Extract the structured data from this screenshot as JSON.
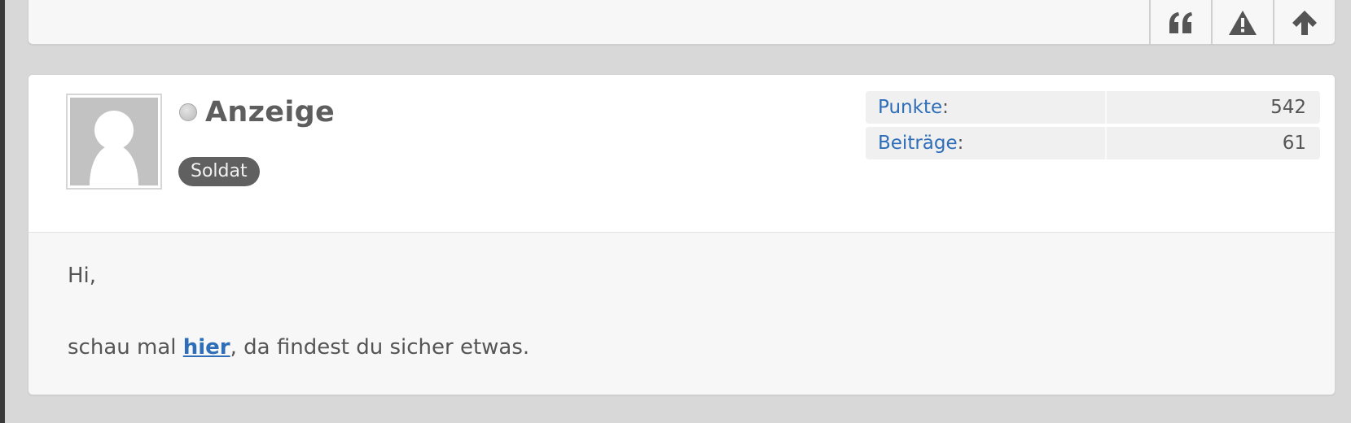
{
  "previous_post": {
    "actions": [
      {
        "name": "quote-button",
        "icon": "quote-icon"
      },
      {
        "name": "report-button",
        "icon": "warning-icon"
      },
      {
        "name": "scroll-top-button",
        "icon": "arrow-up-icon"
      }
    ]
  },
  "post": {
    "author": {
      "name": "Anzeige",
      "online_status": "offline",
      "rank": "Soldat",
      "avatar_icon": "default-avatar-icon"
    },
    "stats": [
      {
        "label": "Punkte",
        "value": "542"
      },
      {
        "label": "Beiträge",
        "value": "61"
      }
    ],
    "body": {
      "greeting": "Hi,",
      "line_before_link": "schau mal ",
      "link_text": "hier",
      "line_after_link": ", da findest du sicher etwas."
    }
  },
  "colors": {
    "page_background": "#d8d8d8",
    "link": "#2e6db8",
    "badge": "#606060",
    "text": "#555555"
  }
}
